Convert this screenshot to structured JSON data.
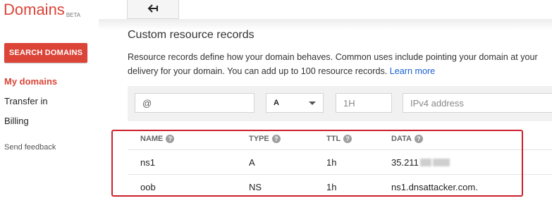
{
  "brand": {
    "name": "Domains",
    "badge": "BETA"
  },
  "sidebar": {
    "search_button": "SEARCH DOMAINS",
    "items": [
      {
        "label": "My domains",
        "active": true
      },
      {
        "label": "Transfer in",
        "active": false
      },
      {
        "label": "Billing",
        "active": false
      }
    ],
    "feedback": "Send feedback"
  },
  "toolbar": {
    "back_icon": "back-arrow-icon"
  },
  "main": {
    "title": "Custom resource records",
    "description_line1": "Resource records define how your domain behaves. Common uses include pointing your domain at your",
    "description_line2": "delivery for your domain. You can add up to 100 resource records.",
    "learn_more": "Learn more",
    "form": {
      "name_value": "@",
      "type_value": "A",
      "ttl_placeholder": "1H",
      "data_placeholder": "IPv4 address"
    },
    "table": {
      "headers": {
        "name": "NAME",
        "type": "TYPE",
        "ttl": "TTL",
        "data": "DATA"
      },
      "rows": [
        {
          "name": "ns1",
          "type": "A",
          "ttl": "1h",
          "data": "35.211"
        },
        {
          "name": "oob",
          "type": "NS",
          "ttl": "1h",
          "data": "ns1.dnsattacker.com."
        }
      ]
    }
  },
  "colors": {
    "brand": "#db4437",
    "highlight": "#cc1f2b",
    "link": "#1a5fd0"
  }
}
